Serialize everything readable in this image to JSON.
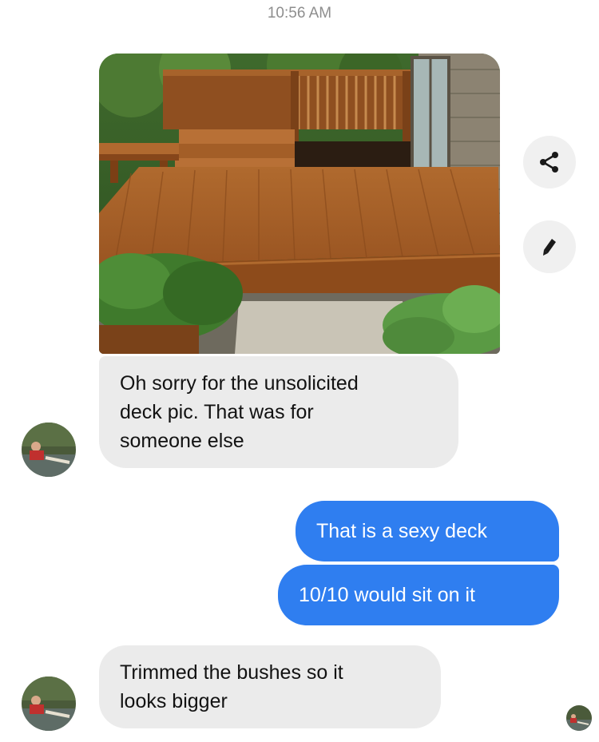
{
  "status": {
    "time": "10:56 AM"
  },
  "photo": {
    "icon": "deck-photo"
  },
  "actions": {
    "share_icon": "share-icon",
    "edit_icon": "pencil-icon"
  },
  "messages": [
    {
      "direction": "incoming",
      "lines": [
        "Oh sorry for the unsolicited",
        "deck pic. That was for",
        "someone else"
      ]
    },
    {
      "direction": "outgoing",
      "text": "That is a sexy deck"
    },
    {
      "direction": "outgoing",
      "text": "10/10 would sit on it"
    },
    {
      "direction": "incoming",
      "lines": [
        "Trimmed the bushes so it",
        "looks bigger"
      ]
    }
  ],
  "colors": {
    "outgoing_bubble": "#2f7ef0",
    "incoming_bubble": "#ebebeb",
    "timestamp": "#8e8e8e"
  }
}
